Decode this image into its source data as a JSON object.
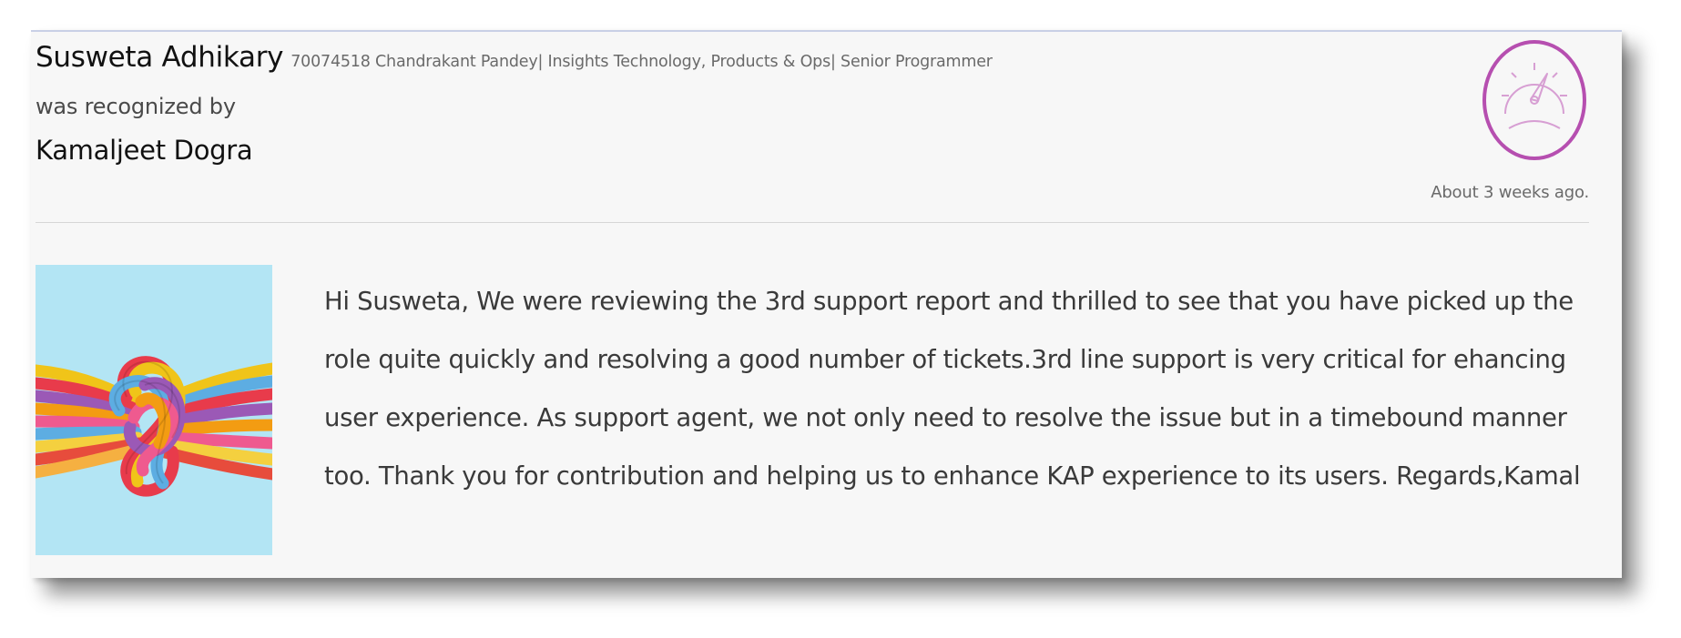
{
  "recognition": {
    "recipient_name": "Susweta Adhikary",
    "recipient_meta": "70074518 Chandrakant Pandey| Insights Technology, Products & Ops| Senior Programmer",
    "recognized_by_text": "was recognized by",
    "giver_name": "Kamaljeet Dogra",
    "time_ago": "About 3 weeks ago.",
    "badge_icon": "speedometer-icon",
    "badge_color": "#b64fb0",
    "image_icon": "knotted-ropes-image",
    "image_background": "#b3e5f4",
    "message_lines": [
      "Hi Susweta, We were reviewing the 3rd support report and thrilled to see that you have picked up the",
      "role quite quickly and resolving a good number of tickets.3rd line support is very critical for ehancing",
      "user experience. As support agent, we not only need to resolve the issue but in a timebound manner",
      "too. Thank you for contribution and helping us to enhance KAP experience to its users. Regards,Kamal"
    ]
  }
}
